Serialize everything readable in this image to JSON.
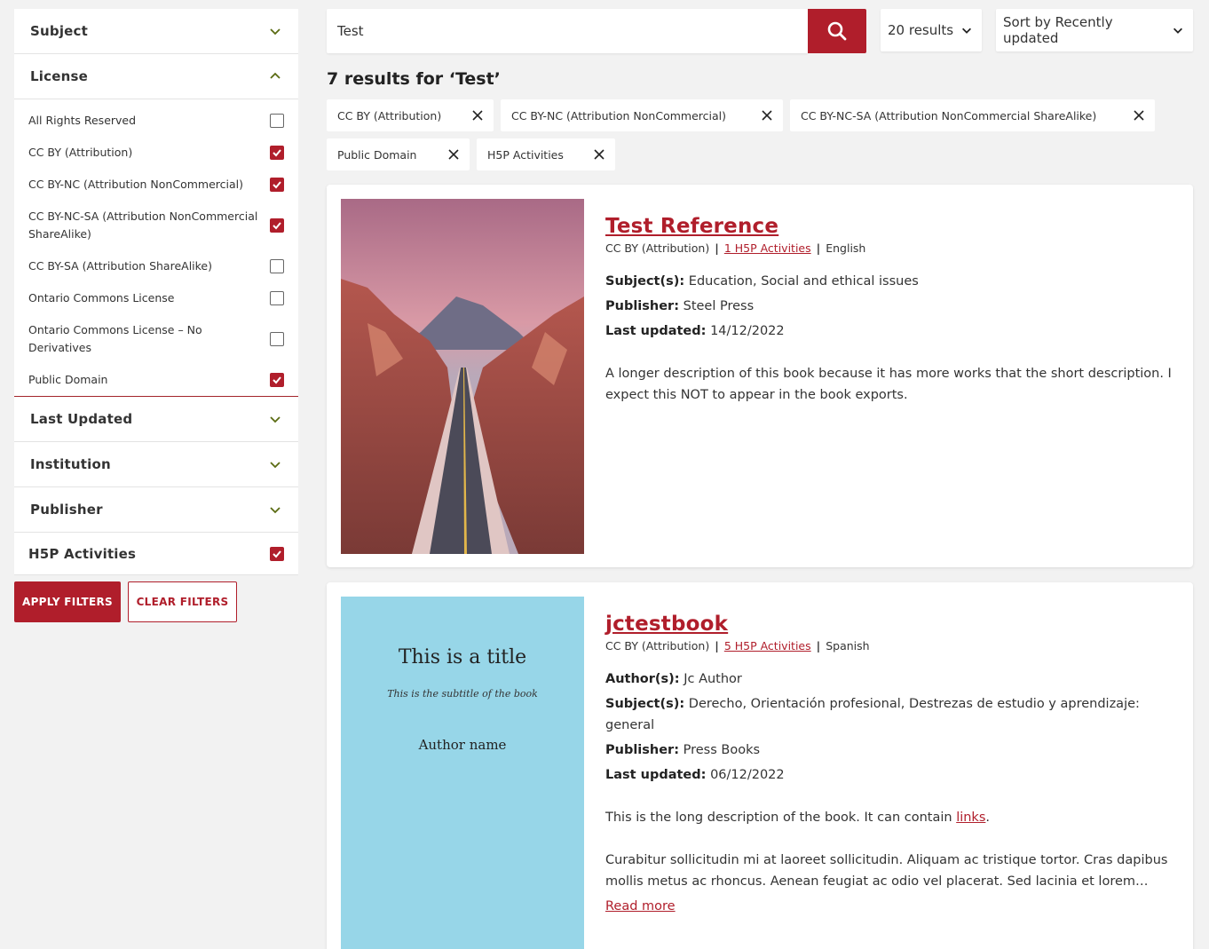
{
  "sidebar": {
    "facets_top": [
      {
        "label": "Subject",
        "expanded": false
      }
    ],
    "license": {
      "label": "License",
      "expanded": true,
      "options": [
        {
          "label": "All Rights Reserved",
          "checked": false
        },
        {
          "label": "CC BY (Attribution)",
          "checked": true
        },
        {
          "label": "CC BY-NC (Attribution NonCommercial)",
          "checked": true
        },
        {
          "label": "CC BY-NC-SA (Attribution NonCommercial ShareAlike)",
          "checked": true
        },
        {
          "label": "CC BY-SA (Attribution ShareAlike)",
          "checked": false
        },
        {
          "label": "Ontario Commons License",
          "checked": false
        },
        {
          "label": "Ontario Commons License – No Derivatives",
          "checked": false
        },
        {
          "label": "Public Domain",
          "checked": true
        }
      ]
    },
    "facets_bottom": [
      {
        "label": "Last Updated",
        "expanded": false
      },
      {
        "label": "Institution",
        "expanded": false
      },
      {
        "label": "Publisher",
        "expanded": false
      }
    ],
    "h5p": {
      "label": "H5P Activities",
      "checked": true
    },
    "apply_label": "APPLY FILTERS",
    "clear_label": "CLEAR FILTERS"
  },
  "search": {
    "value": "Test",
    "icon": "search-icon"
  },
  "per_page": {
    "selected": "20 results"
  },
  "sort": {
    "selected": "Sort by Recently updated"
  },
  "results_heading": "7 results for ‘Test’",
  "active_filters": [
    "CC BY (Attribution)",
    "CC BY-NC (Attribution NonCommercial)",
    "CC BY-NC-SA (Attribution NonCommercial ShareAlike)",
    "Public Domain",
    "H5P Activities"
  ],
  "books": [
    {
      "title": "Test Reference",
      "license": "CC BY (Attribution)",
      "h5p": "1 H5P Activities",
      "language": "English",
      "subjects_label": "Subject(s):",
      "subjects": "Education, Social and ethical issues",
      "publisher_label": "Publisher:",
      "publisher": "Steel Press",
      "updated_label": "Last updated:",
      "updated": "14/12/2022",
      "description": "A longer description of this book because it has more works that the short description. I expect this NOT to appear in the book exports."
    },
    {
      "title": "jctestbook",
      "license": "CC BY (Attribution)",
      "h5p": "5 H5P Activities",
      "language": "Spanish",
      "authors_label": "Author(s):",
      "authors": "Jc Author",
      "subjects_label": "Subject(s):",
      "subjects": "Derecho, Orientación profesional, Destrezas de estudio y aprendizaje: general",
      "publisher_label": "Publisher:",
      "publisher": "Press Books",
      "updated_label": "Last updated:",
      "updated": "06/12/2022",
      "description_pre": "This is the long description of the book. It can contain ",
      "description_link": "links",
      "description_post": ".",
      "description_2": "Curabitur sollicitudin mi at laoreet sollicitudin. Aliquam ac tristique tortor. Cras dapibus mollis metus ac rhoncus. Aenean feugiat ac odio vel placerat. Sed lacinia et lorem imperdiet",
      "read_more": "Read more",
      "cover": {
        "title": "This is a title",
        "subtitle": "This is the subtitle of the book",
        "author": "Author name"
      }
    }
  ],
  "colors": {
    "accent": "#b01e2b",
    "background": "#f2f2f2",
    "cover_blue": "#97d6e8"
  }
}
